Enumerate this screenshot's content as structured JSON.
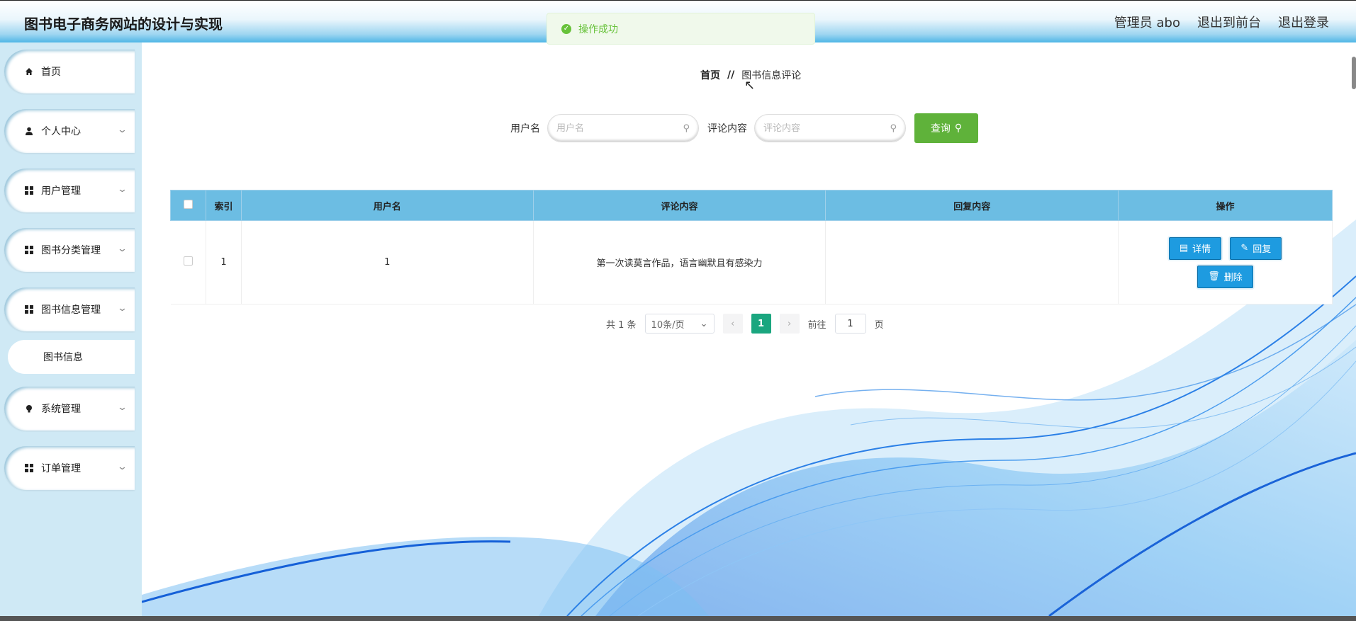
{
  "header": {
    "title": "图书电子商务网站的设计与实现",
    "links": [
      "管理员 abo",
      "退出到前台",
      "退出登录"
    ]
  },
  "toast": {
    "text": "操作成功"
  },
  "sidebar": {
    "items": [
      {
        "label": "首页",
        "icon": "home-icon"
      },
      {
        "label": "个人中心",
        "icon": "user-icon"
      },
      {
        "label": "用户管理",
        "icon": "grid-icon"
      },
      {
        "label": "图书分类管理",
        "icon": "grid-icon"
      },
      {
        "label": "图书信息管理",
        "icon": "grid-icon"
      },
      {
        "label": "系统管理",
        "icon": "bulb-icon"
      },
      {
        "label": "订单管理",
        "icon": "grid-icon"
      }
    ],
    "sub_item": "图书信息"
  },
  "breadcrumb": {
    "home": "首页",
    "separator": "//",
    "current": "图书信息评论"
  },
  "search": {
    "username_label": "用户名",
    "username_placeholder": "用户名",
    "comment_label": "评论内容",
    "comment_placeholder": "评论内容",
    "query_label": "查询"
  },
  "table": {
    "headers": [
      "索引",
      "用户名",
      "评论内容",
      "回复内容",
      "操作"
    ],
    "rows": [
      {
        "index": "1",
        "username": "1",
        "comment": "第一次读莫言作品，语言幽默且有感染力",
        "reply": ""
      }
    ],
    "actions": {
      "detail": "详情",
      "reply": "回复",
      "delete": "删除"
    }
  },
  "pagination": {
    "total": "共 1 条",
    "page_size": "10条/页",
    "current_page": "1",
    "goto_prefix": "前往",
    "goto_value": "1",
    "goto_suffix": "页"
  }
}
